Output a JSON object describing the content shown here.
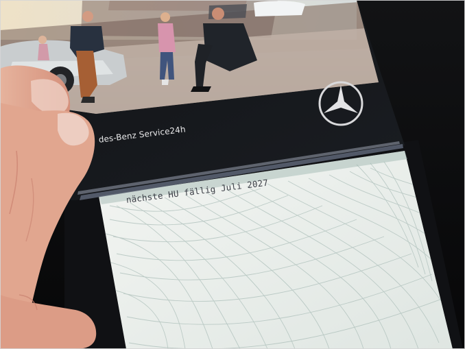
{
  "brochure": {
    "service_text": "des-Benz Service24h",
    "logo": "mercedes-star-logo"
  },
  "certificate": {
    "typed_line": "nächste HU fällig Juli 2027"
  },
  "photo": {
    "subjects": [
      "silver-car",
      "man-standing",
      "girl",
      "man-crouching"
    ]
  },
  "colors": {
    "brochure_dark": "#171a1f",
    "paper": "#e9ece8",
    "paper_pattern": "#b8c7c2",
    "skin": "#e7b19e",
    "text_light": "#e9e9ea"
  }
}
